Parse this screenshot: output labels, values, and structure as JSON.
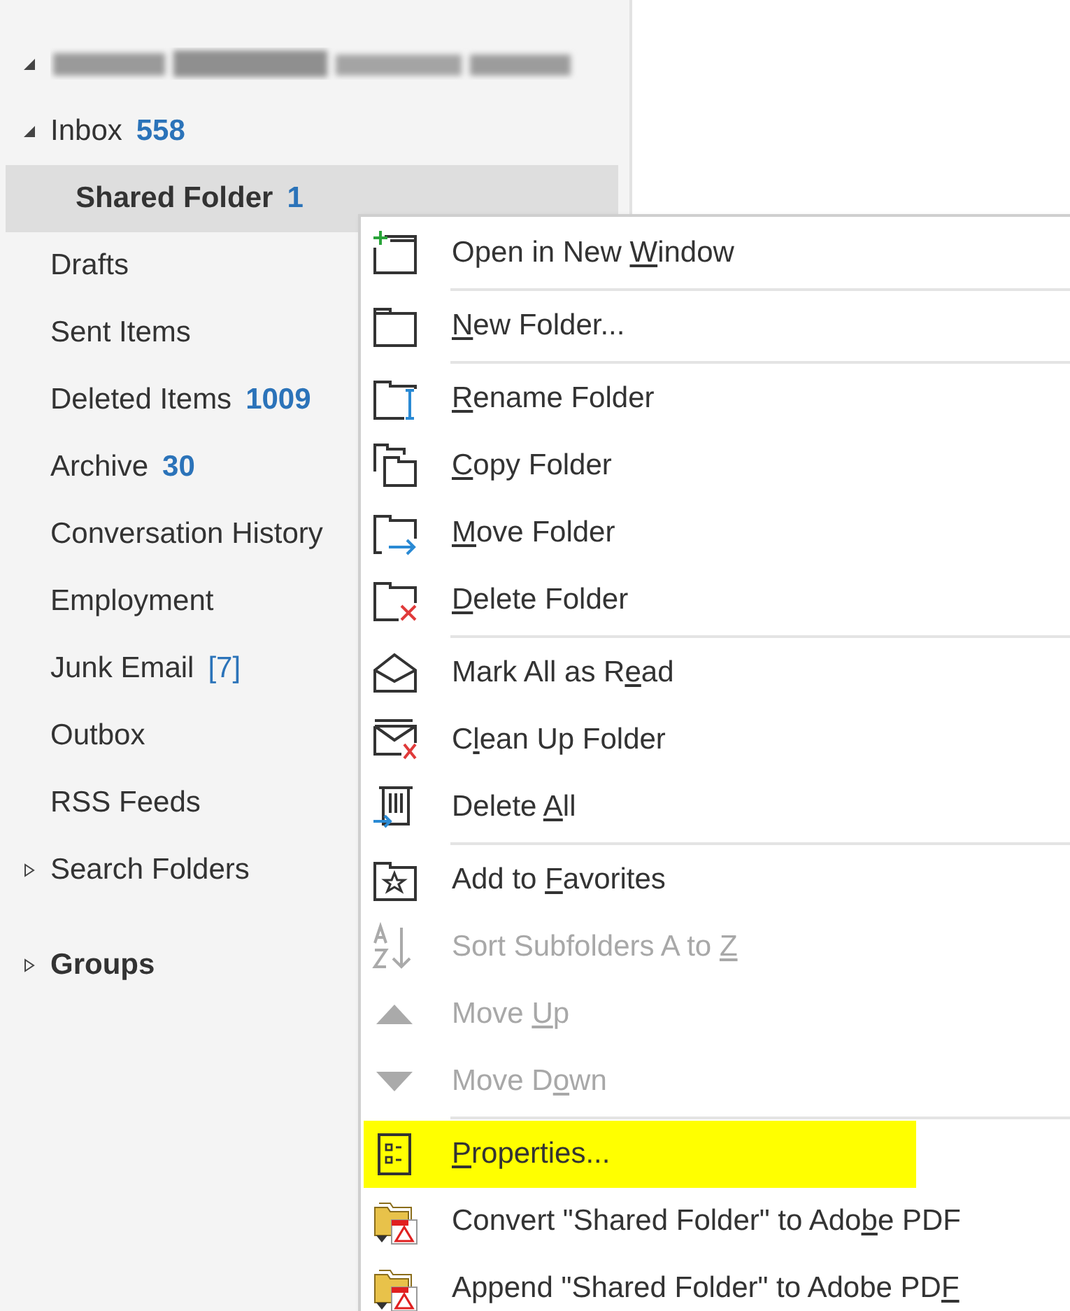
{
  "account": {
    "expanded": true
  },
  "folders": [
    {
      "label": "Inbox",
      "count": "558",
      "count_bold": true,
      "expanded": true,
      "selected": false,
      "children": [
        {
          "label": "Shared Folder",
          "count": "1",
          "count_bold": true,
          "selected": true
        }
      ]
    },
    {
      "label": "Drafts",
      "selected": false
    },
    {
      "label": "Sent Items",
      "selected": false
    },
    {
      "label": "Deleted Items",
      "count": "1009",
      "count_bold": true,
      "selected": false
    },
    {
      "label": "Archive",
      "count": "30",
      "count_bold": true,
      "selected": false
    },
    {
      "label": "Conversation History",
      "selected": false
    },
    {
      "label": "Employment",
      "selected": false
    },
    {
      "label": "Junk Email",
      "count": "[7]",
      "count_bold": false,
      "selected": false
    },
    {
      "label": "Outbox",
      "selected": false
    },
    {
      "label": "RSS Feeds",
      "selected": false
    },
    {
      "label": "Search Folders",
      "expanded": false,
      "selected": false
    }
  ],
  "groups": {
    "label": "Groups",
    "expanded": false
  },
  "context_menu": [
    {
      "kind": "item",
      "before": "Open in New ",
      "key": "W",
      "after": "indow",
      "disabled": false,
      "selected": false
    },
    {
      "kind": "separator"
    },
    {
      "kind": "item",
      "key": "N",
      "after": "ew Folder...",
      "disabled": false,
      "selected": false
    },
    {
      "kind": "separator"
    },
    {
      "kind": "item",
      "key": "R",
      "after": "ename Folder",
      "disabled": false,
      "selected": false
    },
    {
      "kind": "item",
      "key": "C",
      "after": "opy Folder",
      "disabled": false,
      "selected": false
    },
    {
      "kind": "item",
      "key": "M",
      "after": "ove Folder",
      "disabled": false,
      "selected": false
    },
    {
      "kind": "item",
      "key": "D",
      "after": "elete Folder",
      "disabled": false,
      "selected": false
    },
    {
      "kind": "separator"
    },
    {
      "kind": "item",
      "before": "Mark All as R",
      "key": "e",
      "after": "ad",
      "disabled": false,
      "selected": false
    },
    {
      "kind": "item",
      "before": "C",
      "key": "l",
      "after": "ean Up Folder",
      "disabled": false,
      "selected": false
    },
    {
      "kind": "item",
      "before": "Delete ",
      "key": "A",
      "after": "ll",
      "disabled": false,
      "selected": false
    },
    {
      "kind": "separator"
    },
    {
      "kind": "item",
      "before": "Add to ",
      "key": "F",
      "after": "avorites",
      "disabled": false,
      "selected": false
    },
    {
      "kind": "item",
      "before": "Sort Subfolders A to ",
      "key": "Z",
      "disabled": true,
      "selected": false
    },
    {
      "kind": "item",
      "before": "Move ",
      "key": "U",
      "after": "p",
      "disabled": true,
      "selected": false
    },
    {
      "kind": "item",
      "before": "Move D",
      "key": "o",
      "after": "wn",
      "disabled": true,
      "selected": false
    },
    {
      "kind": "separator"
    },
    {
      "kind": "item",
      "key": "P",
      "after": "roperties...",
      "disabled": false,
      "selected": true
    },
    {
      "kind": "item",
      "before": "Convert \"Shared Folder\" to Ado",
      "key": "b",
      "after": "e PDF",
      "disabled": false,
      "selected": false
    },
    {
      "kind": "item",
      "before": "Append \"Shared Folder\" to Adobe PD",
      "key": "F",
      "disabled": false,
      "selected": false
    }
  ]
}
